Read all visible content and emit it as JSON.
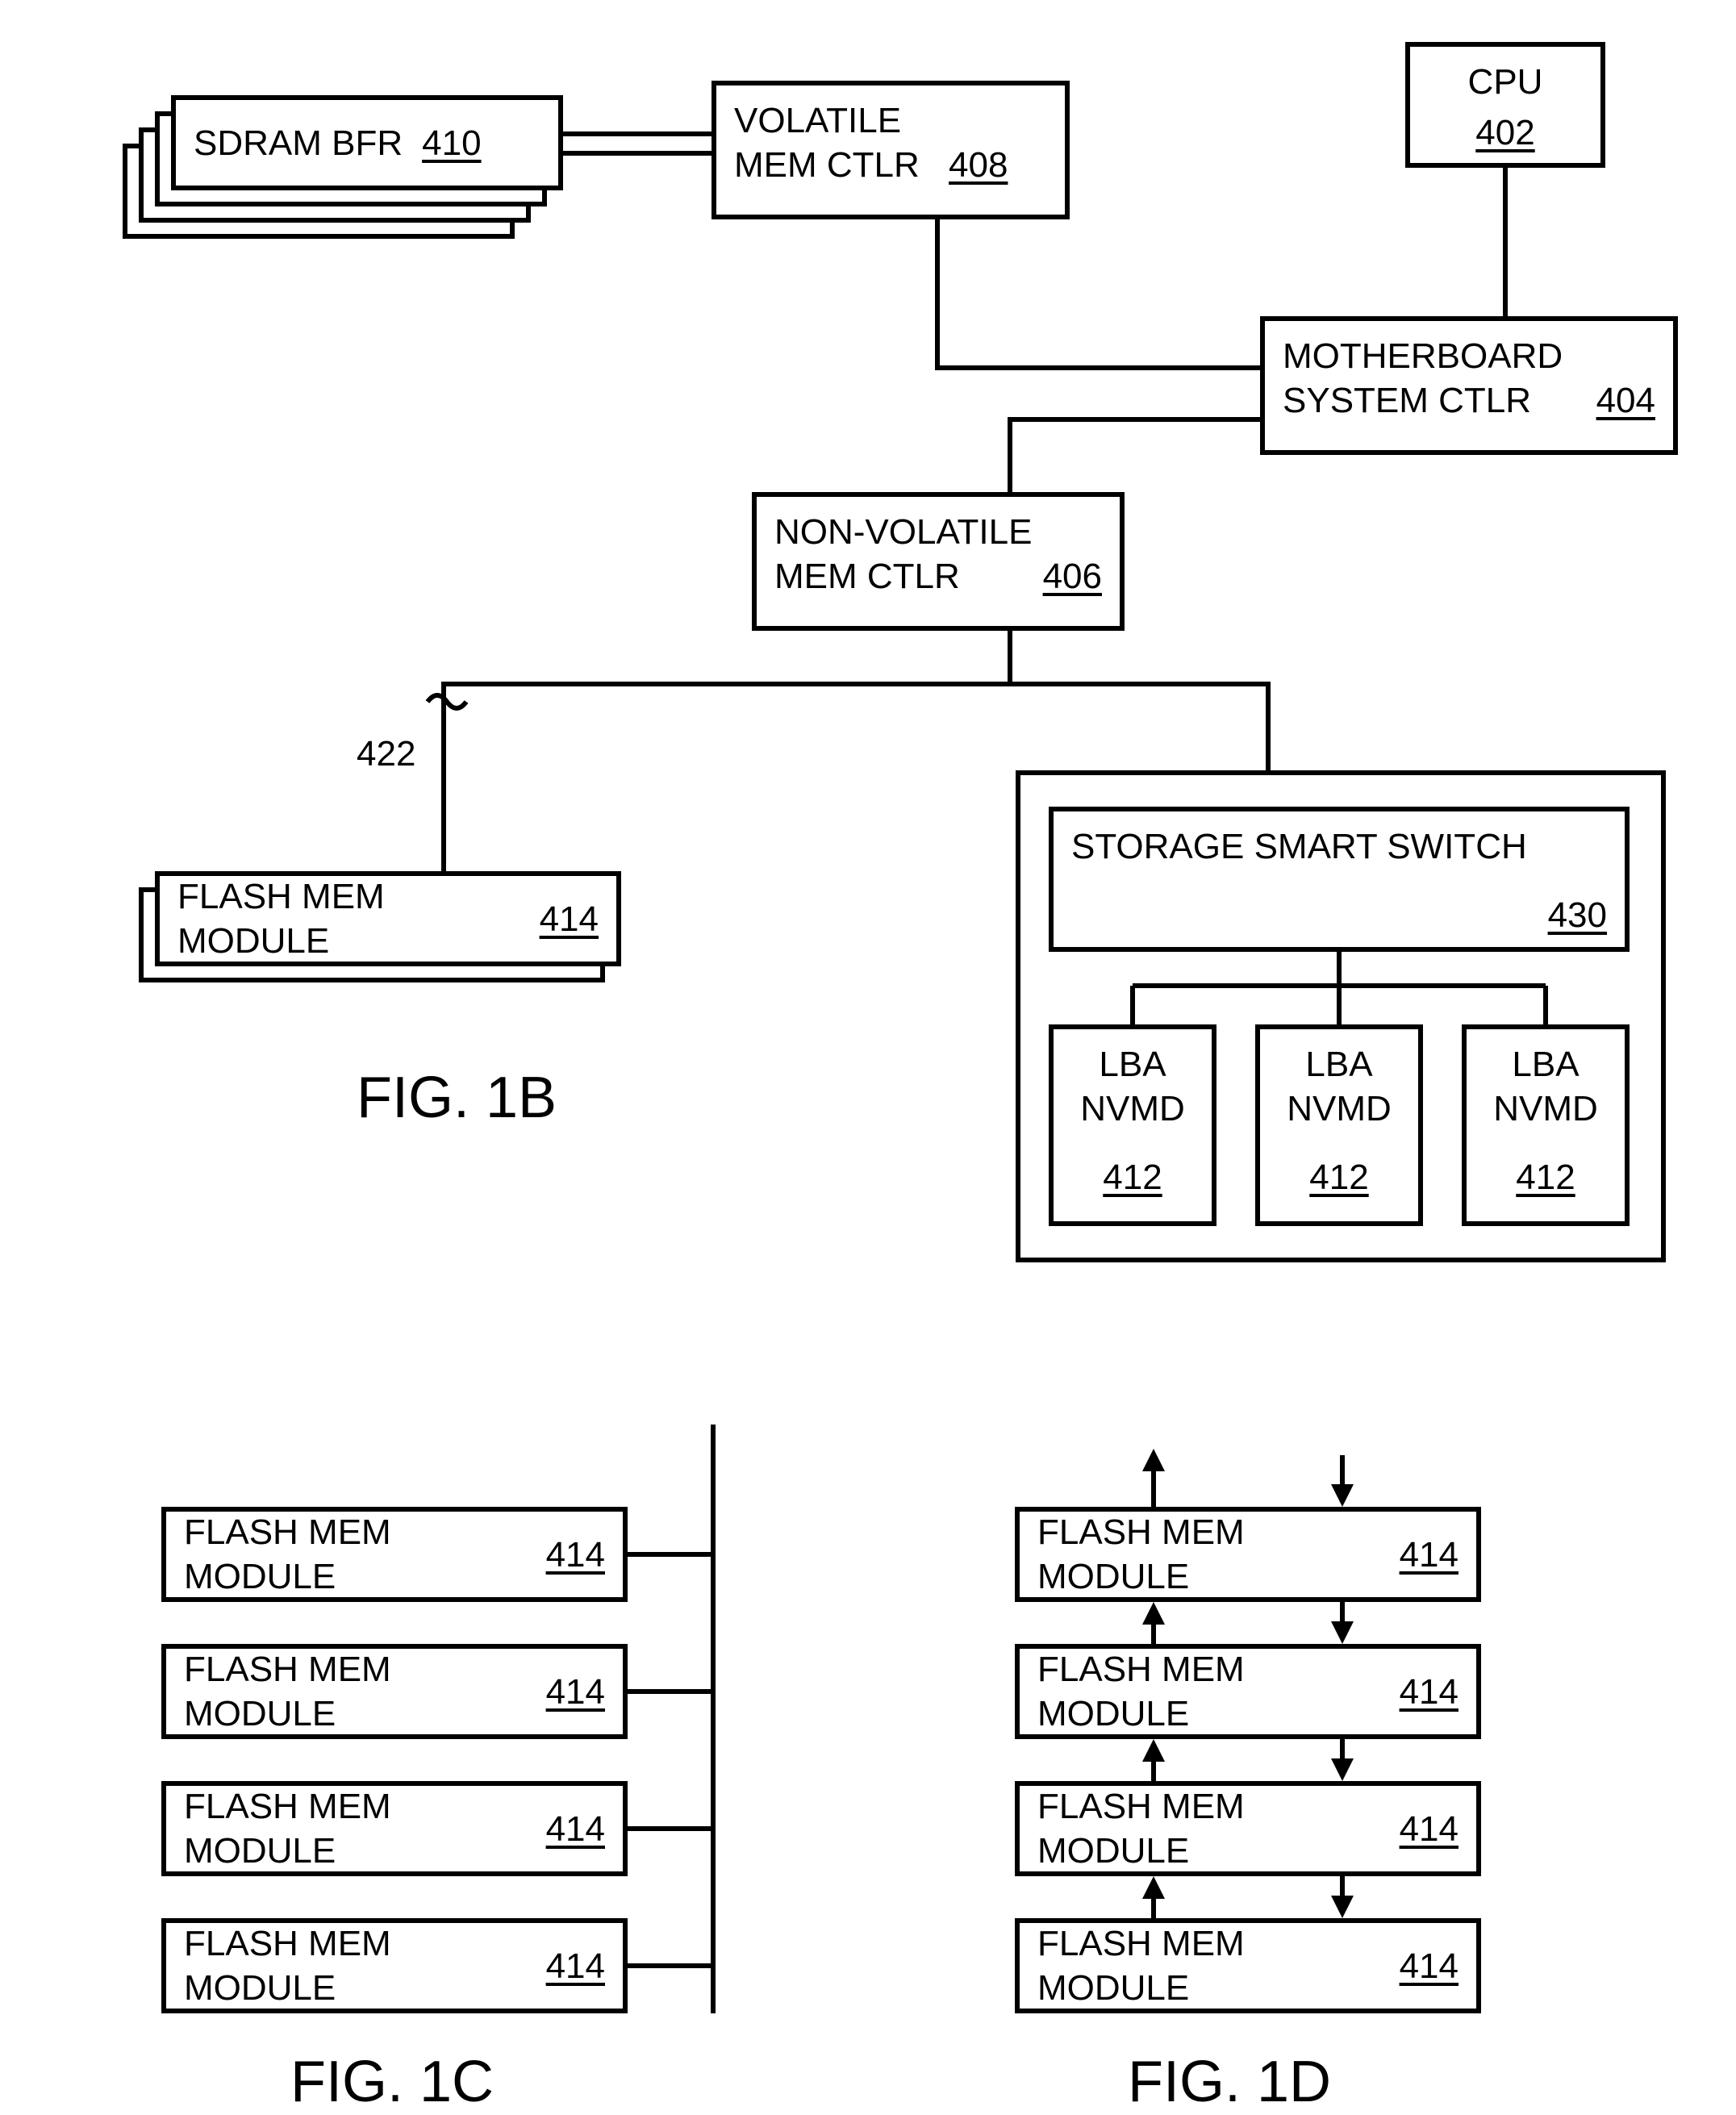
{
  "fig1b": {
    "sdram": {
      "label": "SDRAM  BFR",
      "ref": "410"
    },
    "volmem": {
      "label": "VOLATILE\nMEM CTLR",
      "ref": "408"
    },
    "cpu": {
      "label": "CPU",
      "ref": "402"
    },
    "mobo": {
      "label": "MOTHERBOARD\nSYSTEM CTLR",
      "ref": "404"
    },
    "nvmem": {
      "label": "NON-VOLATILE\nMEM CTLR",
      "ref": "406"
    },
    "flash": {
      "label": "FLASH MEM MODULE",
      "ref": "414"
    },
    "switch": {
      "label": "STORAGE SMART SWITCH",
      "ref": "430"
    },
    "lba": {
      "label": "LBA\nNVMD",
      "ref": "412"
    },
    "wire_ref": "422",
    "title": "FIG. 1B"
  },
  "fig1c": {
    "flash": {
      "label": "FLASH MEM MODULE",
      "ref": "414"
    },
    "title": "FIG. 1C"
  },
  "fig1d": {
    "flash": {
      "label": "FLASH MEM MODULE",
      "ref": "414"
    },
    "title": "FIG. 1D"
  }
}
